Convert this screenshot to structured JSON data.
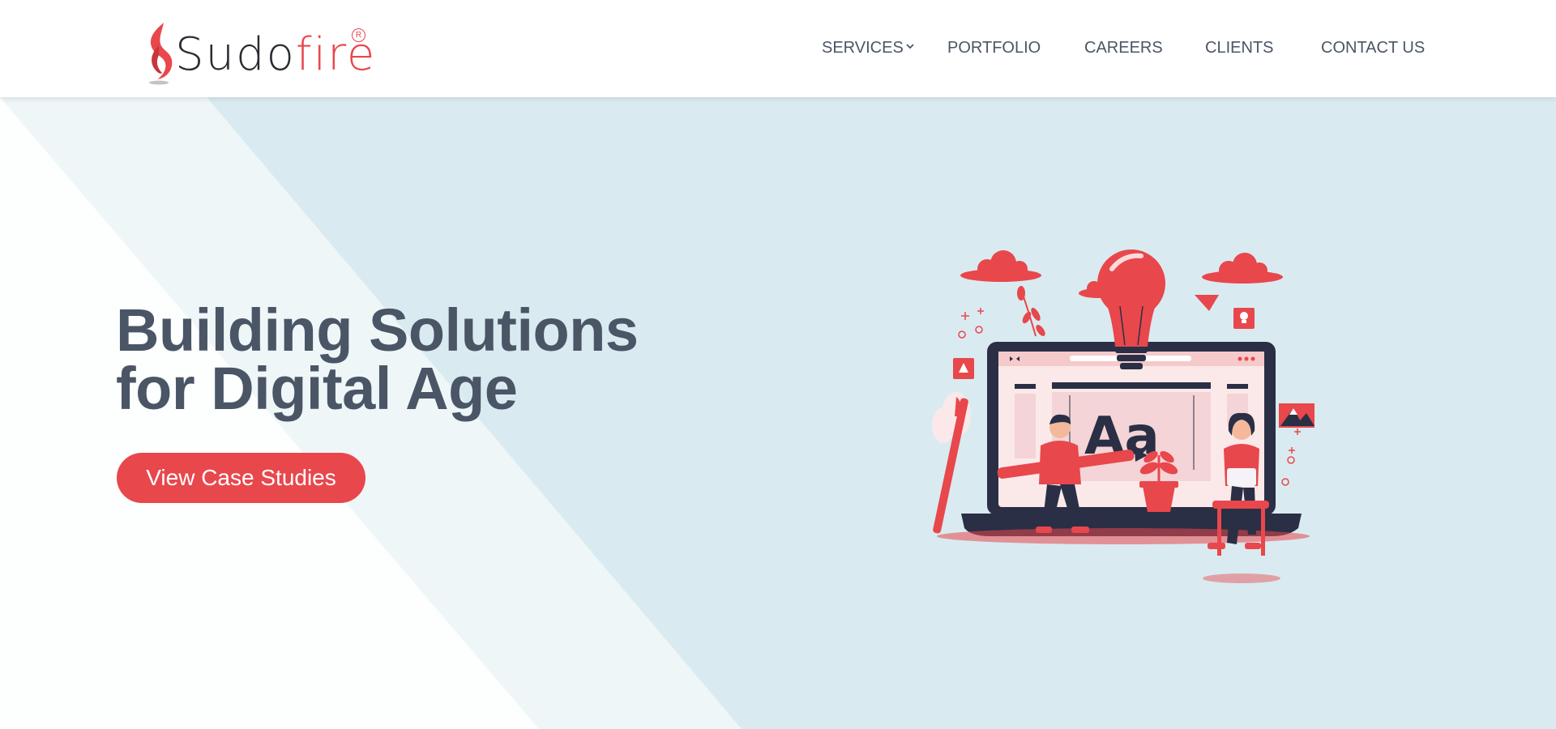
{
  "brand": {
    "name_part1": "Sudo",
    "name_part2": "fire",
    "registered_mark": "R",
    "primary_color": "#e8474c",
    "text_color": "#2b2b33"
  },
  "nav": {
    "items": [
      {
        "label": "SERVICES",
        "has_dropdown": true
      },
      {
        "label": "PORTFOLIO"
      },
      {
        "label": "CAREERS"
      },
      {
        "label": "CLIENTS"
      },
      {
        "label": "CONTACT US"
      }
    ],
    "dropdown_icon": "chevron-down-icon",
    "text_color": "#4a5566"
  },
  "hero": {
    "title_line1": "Building Solutions",
    "title_line2": "for Digital Age",
    "cta_label": "View Case Studies",
    "background_color": "#d9ebf0",
    "title_color": "#4a5566",
    "cta_color": "#e8474c"
  },
  "illustration": {
    "screen_text": "Aa",
    "icons": [
      "lightbulb-icon",
      "cloud-icon",
      "laptop-icon",
      "pencil-icon",
      "plant-icon",
      "mountain-image-icon",
      "pen-tool-icon"
    ],
    "accent_color": "#e8474c",
    "dark_color": "#2a2f45"
  }
}
